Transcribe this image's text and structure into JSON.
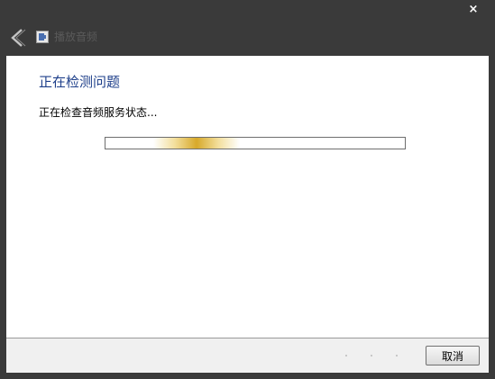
{
  "window": {
    "title": "播放音频",
    "close_label": "×"
  },
  "main": {
    "heading": "正在检测问题",
    "status_text": "正在检查音频服务状态...",
    "progress": {
      "segment_start": 0.16,
      "segment_end": 0.45
    }
  },
  "footer": {
    "cancel_label": "取消"
  },
  "colors": {
    "titlebar_bg": "#3a3a3a",
    "heading_color": "#1e3f8a",
    "progress_fill": "#d7a92b"
  },
  "icons": {
    "back": "back-arrow-icon",
    "app": "audio-troubleshooter-icon",
    "close": "close-icon"
  }
}
